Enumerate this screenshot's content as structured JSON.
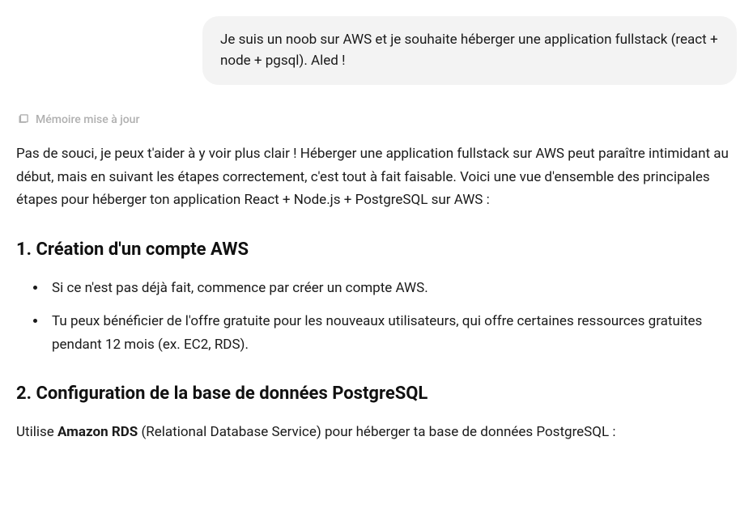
{
  "user_message": {
    "text": "Je suis un noob sur AWS et je souhaite héberger une application fullstack (react + node + pgsql). Aled !"
  },
  "memory": {
    "label": "Mémoire mise à jour"
  },
  "assistant": {
    "intro": "Pas de souci, je peux t'aider à y voir plus clair ! Héberger une application fullstack sur AWS peut paraître intimidant au début, mais en suivant les étapes correctement, c'est tout à fait faisable. Voici une vue d'ensemble des principales étapes pour héberger ton application React + Node.js + PostgreSQL sur AWS :",
    "section1": {
      "heading": "1. Création d'un compte AWS",
      "items": [
        "Si ce n'est pas déjà fait, commence par créer un compte AWS.",
        "Tu peux bénéficier de l'offre gratuite pour les nouveaux utilisateurs, qui offre certaines ressources gratuites pendant 12 mois (ex. EC2, RDS)."
      ]
    },
    "section2": {
      "heading": "2. Configuration de la base de données PostgreSQL",
      "para_prefix": "Utilise ",
      "para_bold": "Amazon RDS",
      "para_suffix": " (Relational Database Service) pour héberger ta base de données PostgreSQL :"
    }
  }
}
